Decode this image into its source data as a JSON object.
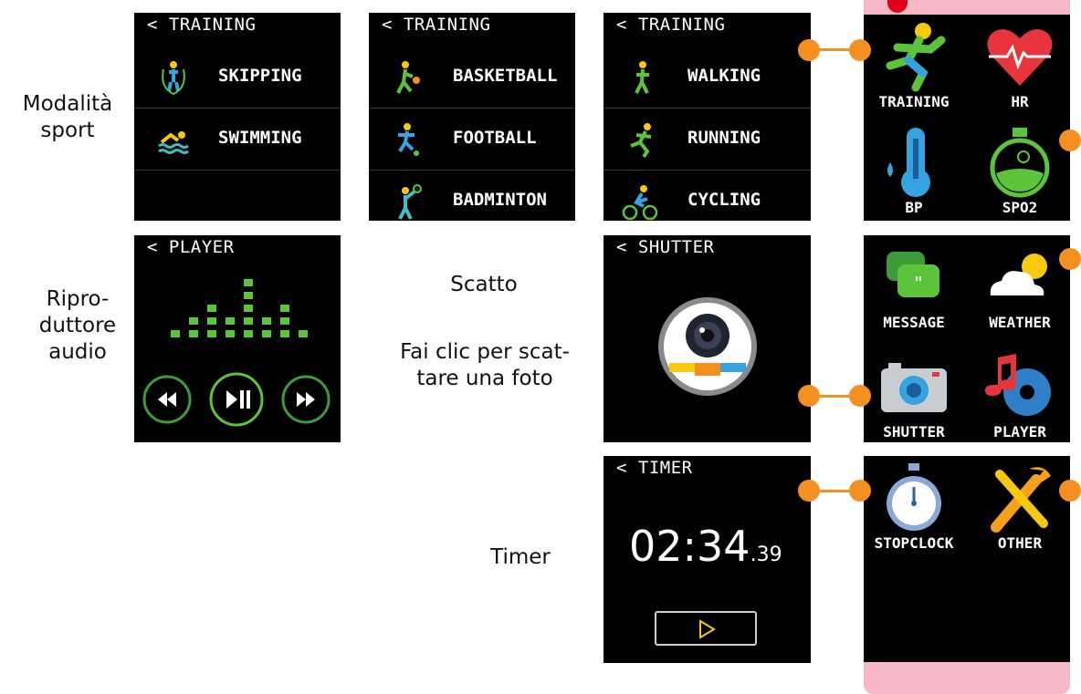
{
  "captions": {
    "sport": [
      "Modalità",
      "sport"
    ],
    "player": [
      "Ripro-",
      "duttore",
      "audio"
    ],
    "shutter_title": "Scatto",
    "shutter_desc": [
      "Fai clic per scat-",
      "tare una foto"
    ],
    "timer": "Timer"
  },
  "training1": {
    "header": "< TRAINING",
    "items": [
      {
        "label": "SKIPPING",
        "icon": "skipping-icon"
      },
      {
        "label": "SWIMMING",
        "icon": "swimming-icon"
      }
    ]
  },
  "training2": {
    "header": "< TRAINING",
    "items": [
      {
        "label": "BASKETBALL",
        "icon": "basketball-icon"
      },
      {
        "label": "FOOTBALL",
        "icon": "football-icon"
      },
      {
        "label": "BADMINTON",
        "icon": "badminton-icon"
      }
    ]
  },
  "training3": {
    "header": "< TRAINING",
    "items": [
      {
        "label": "WALKING",
        "icon": "walking-icon"
      },
      {
        "label": "RUNNING",
        "icon": "running-icon"
      },
      {
        "label": "CYCLING",
        "icon": "cycling-icon"
      }
    ]
  },
  "player": {
    "header": "< PLAYER",
    "controls": [
      "rewind-icon",
      "play-pause-icon",
      "fast-forward-icon"
    ]
  },
  "shutter": {
    "header": "< SHUTTER",
    "button_icon": "camera-shutter-icon"
  },
  "timer": {
    "header": "< TIMER",
    "time_main": "02:34",
    "time_fraction": ".39",
    "button_icon": "play-icon"
  },
  "menu": {
    "apps": [
      {
        "label": "TRAINING",
        "icon": "runner-icon"
      },
      {
        "label": "HR",
        "icon": "heart-rate-icon"
      },
      {
        "label": "BP",
        "icon": "thermometer-icon"
      },
      {
        "label": "SPO2",
        "icon": "oxygen-flask-icon"
      },
      {
        "label": "MESSAGE",
        "icon": "message-icon"
      },
      {
        "label": "WEATHER",
        "icon": "weather-icon"
      },
      {
        "label": "SHUTTER",
        "icon": "camera-icon"
      },
      {
        "label": "PLAYER",
        "icon": "music-disc-icon"
      },
      {
        "label": "STOPCLOCK",
        "icon": "stopwatch-icon"
      },
      {
        "label": "OTHER",
        "icon": "tools-icon"
      }
    ]
  },
  "colors": {
    "accent_orange": "#f39021",
    "band_pink": "#f7b9c7",
    "equalizer_green": "#5cc43a",
    "marker_red": "#e0001a"
  }
}
